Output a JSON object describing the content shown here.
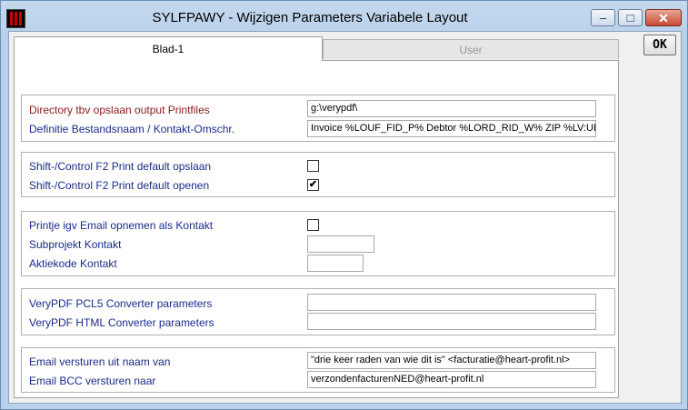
{
  "window": {
    "title": "SYLFPAWY - Wijzigen Parameters Variabele Layout",
    "controls": {
      "minimize": "–",
      "maximize": "□",
      "close": "✕"
    }
  },
  "tabs": [
    {
      "label": "Blad-1",
      "active": true
    },
    {
      "label": "User",
      "active": false
    }
  ],
  "ok_label": "OK",
  "groups": {
    "output": {
      "dir_label": "Directory tbv opslaan output Printfiles",
      "dir_value": "g:\\verypdf\\",
      "name_label": "Definitie Bestandsnaam / Kontakt-Omschr.",
      "name_value": "Invoice %LOUF_FID_P% Debtor %LORD_RID_W% ZIP %LV:UF-A"
    },
    "print": {
      "save_label": "Shift-/Control F2 Print default opslaan",
      "save_checked": false,
      "open_label": "Shift-/Control F2 Print default openen",
      "open_checked": true
    },
    "contact": {
      "email_label": "Printje igv Email opnemen als Kontakt",
      "email_checked": false,
      "subproject_label": "Subprojekt Kontakt",
      "subproject_value": "",
      "action_label": "Aktiekode Kontakt",
      "action_value": ""
    },
    "verypdf": {
      "pcl5_label": "VeryPDF PCL5 Converter parameters",
      "pcl5_value": "",
      "html_label": "VeryPDF HTML Converter parameters",
      "html_value": ""
    },
    "mail": {
      "from_label": "Email versturen uit naam van",
      "from_value": "\"drie keer raden van wie dit is\" <facturatie@heart-profit.nl>",
      "bcc_label": "Email BCC versturen naar",
      "bcc_value": "verzondenfacturenNED@heart-profit.nl"
    }
  },
  "colors": {
    "frame": "#b9d1ea",
    "label_blue": "#1a2b8a",
    "label_red": "#8b1a1a"
  }
}
